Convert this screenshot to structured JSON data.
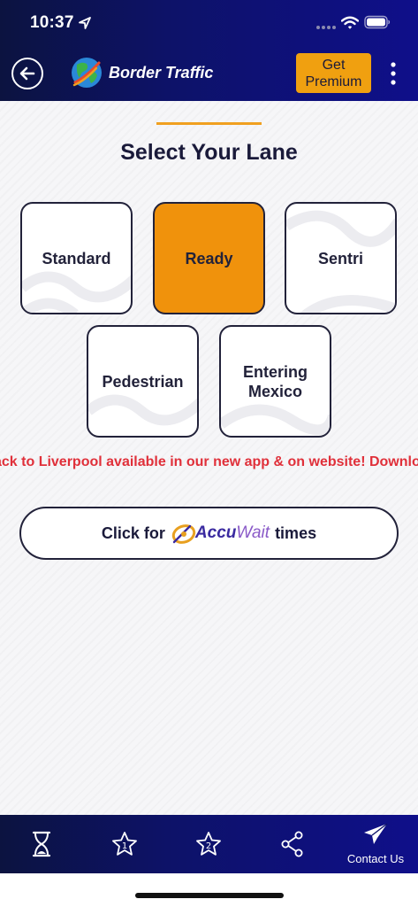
{
  "status": {
    "time": "10:37"
  },
  "header": {
    "title": "Border Traffic",
    "premium_label": "Get Premium"
  },
  "main": {
    "title": "Select Your Lane",
    "lanes": [
      {
        "label": "Standard",
        "selected": false
      },
      {
        "label": "Ready",
        "selected": true
      },
      {
        "label": "Sentri",
        "selected": false
      },
      {
        "label": "Pedestrian",
        "selected": false
      },
      {
        "label": "Entering Mexico",
        "selected": false
      }
    ],
    "ticker": "ack to Liverpool available in our new app & on website! Download",
    "accuwait": {
      "prefix": "Click for",
      "brand_a": "Accu",
      "brand_b": "Wait",
      "suffix": "times"
    }
  },
  "tabbar": {
    "contact_label": "Contact Us"
  },
  "colors": {
    "accent": "#f0920c",
    "header": "#0d1268",
    "ticker": "#e0303a"
  }
}
